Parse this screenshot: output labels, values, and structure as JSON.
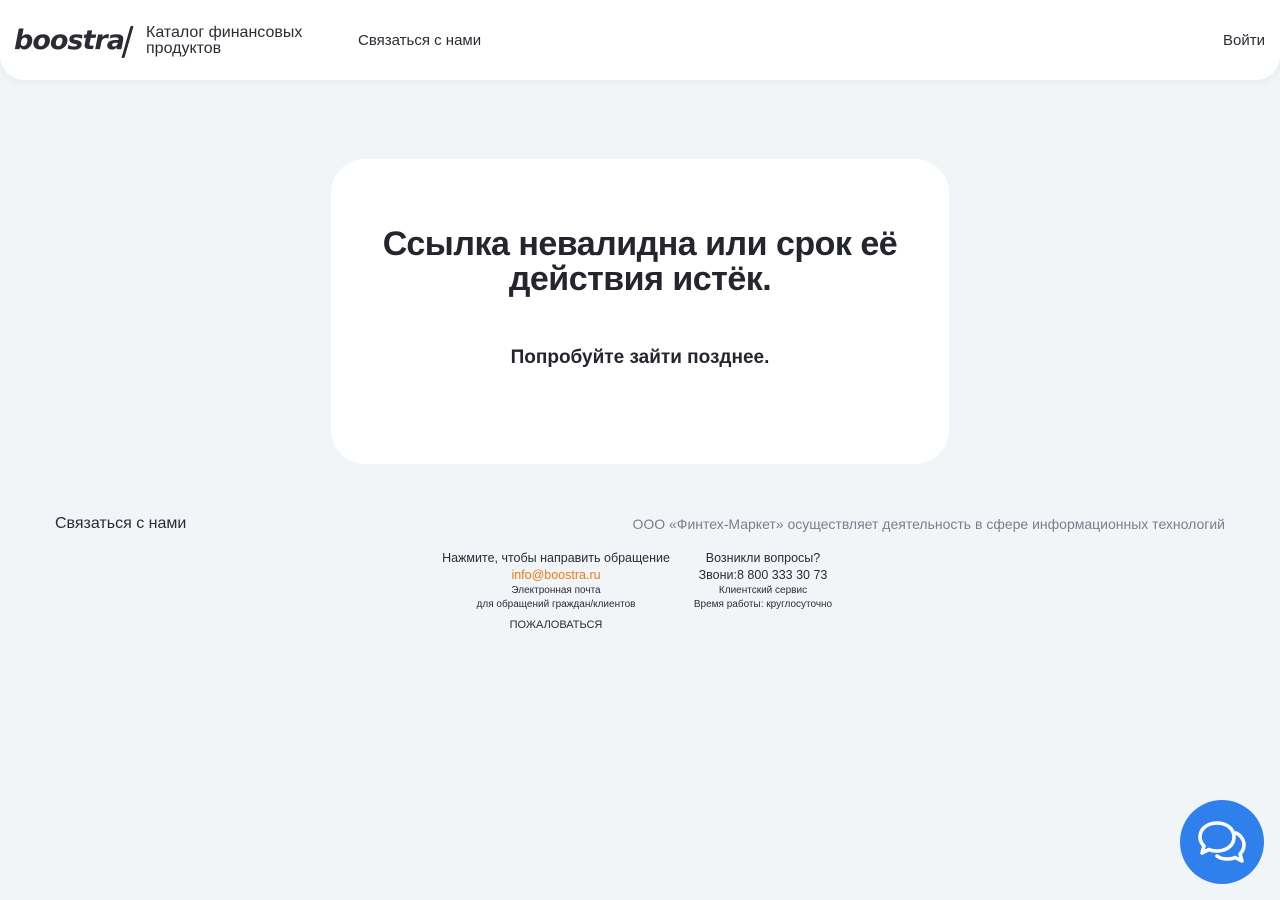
{
  "header": {
    "logo_text": "boostra",
    "catalog_title": "Каталог финансовых продуктов",
    "nav_contact": "Связаться с нами",
    "login": "Войти"
  },
  "card": {
    "title": "Ссылка невалидна или срок её действия истёк.",
    "subtitle": "Попробуйте зайти позднее."
  },
  "footer": {
    "contact_label": "Связаться с нами",
    "legal": "ООО «Финтех-Маркет» осуществляет деятельность в сфере информационных технологий",
    "email_block": {
      "hint": "Нажмите, чтобы направить обращение",
      "email": "info@boostra.ru",
      "caption_line1": "Электронная почта",
      "caption_line2": "для обращений граждан/клиентов",
      "complain": "ПОЖАЛОВАТЬСЯ"
    },
    "phone_block": {
      "question": "Возникли вопросы?",
      "phone": "Звони:8 800 333 30 73",
      "service": "Клиентский сервис",
      "hours": "Время работы: круглосуточно"
    }
  },
  "chat": {
    "icon": "chat-bubbles-icon",
    "color": "#2f80ed"
  },
  "colors": {
    "background": "#f2f5f8",
    "accent_orange": "#f07b16",
    "text_dark": "#2b2b36",
    "text_muted": "#7a7f8a"
  }
}
